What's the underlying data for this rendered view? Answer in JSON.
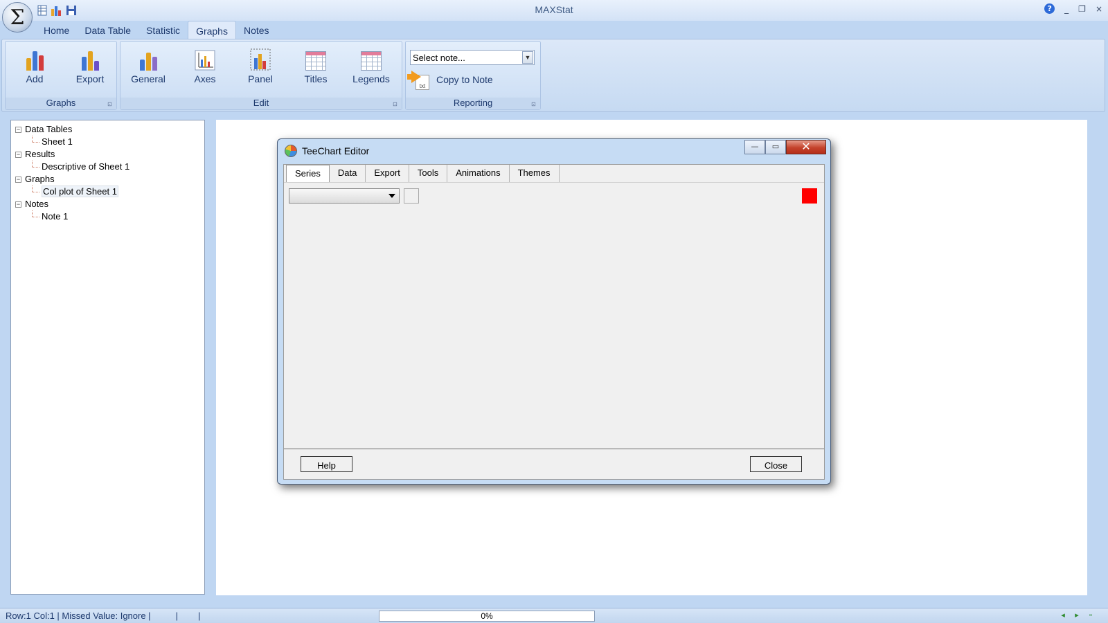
{
  "window": {
    "title": "MAXStat",
    "orb_symbol": "Σ"
  },
  "icons": {
    "orb": "sigma-icon",
    "qat": [
      "table-icon",
      "chart-icon",
      "save-icon"
    ],
    "help": "help-icon",
    "minimize": "minimize-icon",
    "restore": "restore-icon",
    "close": "close-icon"
  },
  "window_controls": {
    "help": "?",
    "minimize": "_",
    "restore": "❐",
    "close": "×"
  },
  "tabs": [
    {
      "label": "Home"
    },
    {
      "label": "Data Table"
    },
    {
      "label": "Statistic"
    },
    {
      "label": "Graphs",
      "active": true
    },
    {
      "label": "Notes"
    }
  ],
  "ribbon": {
    "graphs_group": {
      "label": "Graphs",
      "buttons": [
        {
          "label": "Add"
        },
        {
          "label": "Export"
        }
      ]
    },
    "edit_group": {
      "label": "Edit",
      "buttons": [
        {
          "label": "General"
        },
        {
          "label": "Axes"
        },
        {
          "label": "Panel"
        },
        {
          "label": "Titles"
        },
        {
          "label": "Legends"
        }
      ]
    },
    "reporting_group": {
      "label": "Reporting",
      "note_select": "Select note...",
      "copy_to_note": "Copy to Note",
      "txt": "txt"
    },
    "launcher": "⊡"
  },
  "tree": {
    "toggle": "−",
    "nodes": [
      {
        "label": "Data Tables",
        "children": [
          "Sheet 1"
        ]
      },
      {
        "label": "Results",
        "children": [
          "Descriptive of Sheet 1"
        ]
      },
      {
        "label": "Graphs",
        "children": [
          "Col plot of Sheet 1"
        ]
      },
      {
        "label": "Notes",
        "children": [
          "Note 1"
        ]
      }
    ]
  },
  "status": {
    "text": "Row:1 Col:1 | Missed Value: Ignore |          |        |",
    "progress": "0%",
    "icons": [
      "arrow-left-icon",
      "arrow-right-icon",
      "new-note-icon"
    ],
    "glyphs": [
      "◂",
      "▸",
      "▫"
    ]
  },
  "dialog": {
    "title": "TeeChart Editor",
    "controls": {
      "minimize": "—",
      "maximize": "▭",
      "close": "✕"
    },
    "tabs": [
      {
        "label": "Series",
        "active": true
      },
      {
        "label": "Data"
      },
      {
        "label": "Export"
      },
      {
        "label": "Tools"
      },
      {
        "label": "Animations"
      },
      {
        "label": "Themes"
      }
    ],
    "series_color": "#ff0000",
    "help_button": "Help",
    "close_button": "Close"
  }
}
